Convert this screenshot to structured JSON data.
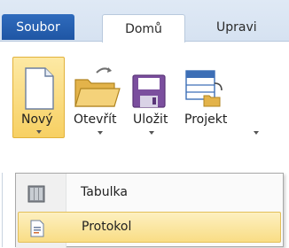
{
  "tabs": {
    "file_label": "Soubor",
    "home_label": "Domů",
    "edit_label": "Upravi"
  },
  "ribbon": {
    "new_label": "Nový",
    "open_label": "Otevřít",
    "save_label": "Uložit",
    "project_label": "Projekt"
  },
  "menu": {
    "items": [
      {
        "label": "Tabulka",
        "icon": "table-icon"
      },
      {
        "label": "Protokol",
        "icon": "protocol-icon"
      }
    ]
  }
}
